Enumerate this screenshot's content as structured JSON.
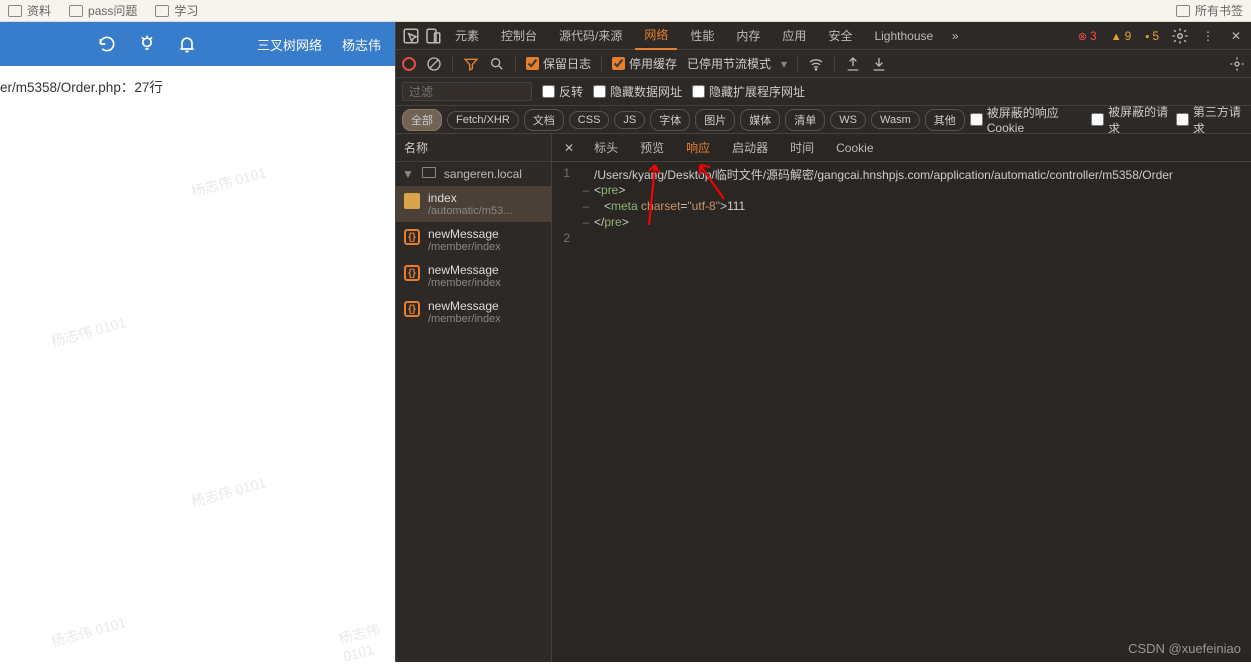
{
  "bookmarks": {
    "items": [
      "资料",
      "pass问题",
      "学习"
    ],
    "right": "所有书签"
  },
  "blueBar": {
    "org": "三叉树网络",
    "user": "杨志伟"
  },
  "leftInfo": "er/m5358/Order.php：27行",
  "watermark": "杨志伟 0101",
  "devtools": {
    "tabs": [
      "元素",
      "控制台",
      "源代码/来源",
      "网络",
      "性能",
      "内存",
      "应用",
      "安全",
      "Lighthouse"
    ],
    "activeTab": "网络",
    "errors": "3",
    "warnings": "9",
    "issues": "5",
    "toolbar": {
      "preserveLog": "保留日志",
      "disableCache": "停用缓存",
      "throttle": "已停用节流模式"
    },
    "filter": {
      "placeholder": "过滤",
      "invert": "反转",
      "hideData": "隐藏数据网址",
      "hideExt": "隐藏扩展程序网址"
    },
    "types": [
      "全部",
      "Fetch/XHR",
      "文档",
      "CSS",
      "JS",
      "字体",
      "图片",
      "媒体",
      "清单",
      "WS",
      "Wasm",
      "其他"
    ],
    "extraChecks": [
      "被屏蔽的响应 Cookie",
      "被屏蔽的请求",
      "第三方请求"
    ],
    "nameHeader": "名称",
    "domain": "sangeren.local",
    "requests": [
      {
        "name": "index",
        "path": "/automatic/m53..."
      },
      {
        "name": "newMessage",
        "path": "/member/index"
      },
      {
        "name": "newMessage",
        "path": "/member/index"
      },
      {
        "name": "newMessage",
        "path": "/member/index"
      }
    ],
    "detailTabs": [
      "标头",
      "预览",
      "响应",
      "启动器",
      "时间",
      "Cookie"
    ],
    "activeDetail": "响应",
    "response": {
      "line1": "/Users/kyang/Desktop/临时文件/源码解密/gangcai.hnshpjs.com/application/automatic/controller/m5358/Order",
      "metaText": "111"
    }
  },
  "csdn": "CSDN @xuefeiniao"
}
